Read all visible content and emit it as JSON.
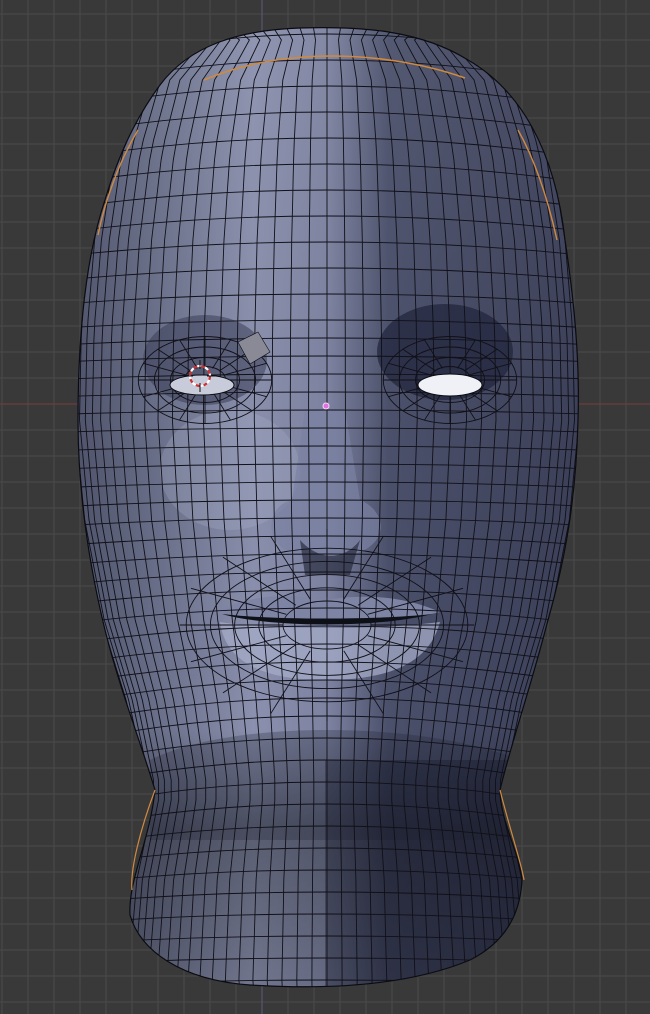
{
  "viewport": {
    "background_color": "#393939",
    "grid_minor_color": "#4a4a4a",
    "grid_major_color": "#555555",
    "axis_x_color": "#7a3a3a",
    "axis_y_color": "#5a5a7a"
  },
  "mesh": {
    "name": "head",
    "face_light_color": "#9aa0c0",
    "face_mid_color": "#6b7090",
    "face_dark_color": "#2a2e44",
    "edge_color": "#101018",
    "selected_edge_color": "#d08a40"
  },
  "cursor": {
    "name": "3d-cursor",
    "color_a": "#d03030",
    "color_b": "#ffffff"
  },
  "origin": {
    "name": "object-origin",
    "color": "#e070e0"
  }
}
